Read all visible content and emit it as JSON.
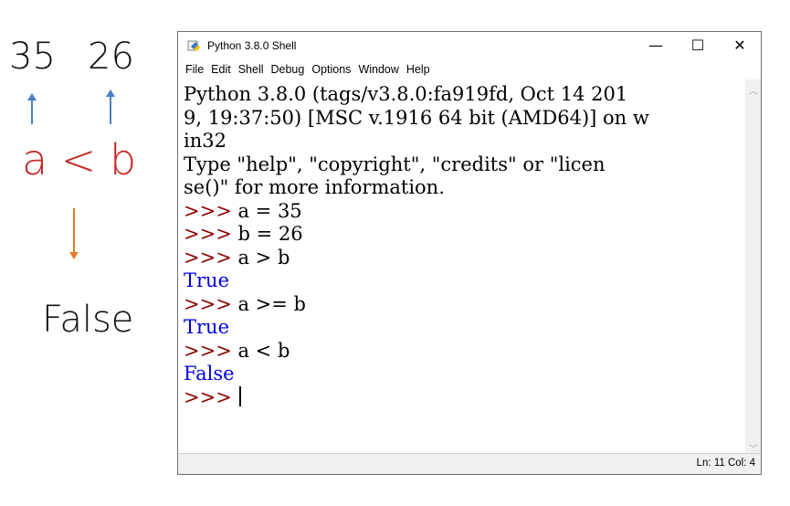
{
  "annotation": {
    "left_number": "35",
    "right_number": "26",
    "expression": "a < b",
    "result": "False",
    "colors": {
      "up_arrows": "#4a7fc9",
      "expression": "#c62828",
      "down_arrow": "#e67c2a"
    }
  },
  "window": {
    "title": "Python 3.8.0 Shell",
    "controls": {
      "minimize": "—",
      "maximize": "☐",
      "close": "✕"
    },
    "menu": [
      "File",
      "Edit",
      "Shell",
      "Debug",
      "Options",
      "Window",
      "Help"
    ],
    "shell_lines": [
      {
        "kind": "text",
        "text": "Python 3.8.0 (tags/v3.8.0:fa919fd, Oct 14 201"
      },
      {
        "kind": "text",
        "text": "9, 19:37:50) [MSC v.1916 64 bit (AMD64)] on w"
      },
      {
        "kind": "text",
        "text": "in32"
      },
      {
        "kind": "text",
        "text": "Type \"help\", \"copyright\", \"credits\" or \"licen"
      },
      {
        "kind": "text",
        "text": "se()\" for more information."
      },
      {
        "kind": "input",
        "prompt": ">>>",
        "text": " a = 35"
      },
      {
        "kind": "input",
        "prompt": ">>>",
        "text": " b = 26"
      },
      {
        "kind": "input",
        "prompt": ">>>",
        "text": " a > b"
      },
      {
        "kind": "output",
        "text": "True"
      },
      {
        "kind": "input",
        "prompt": ">>>",
        "text": " a >= b"
      },
      {
        "kind": "output",
        "text": "True"
      },
      {
        "kind": "input",
        "prompt": ">>>",
        "text": " a < b"
      },
      {
        "kind": "output",
        "text": "False"
      },
      {
        "kind": "current",
        "prompt": ">>>",
        "text": " "
      }
    ],
    "status": "Ln: 11  Col: 4",
    "colors": {
      "prompt": "#8b0000",
      "output": "#0000dd"
    }
  }
}
